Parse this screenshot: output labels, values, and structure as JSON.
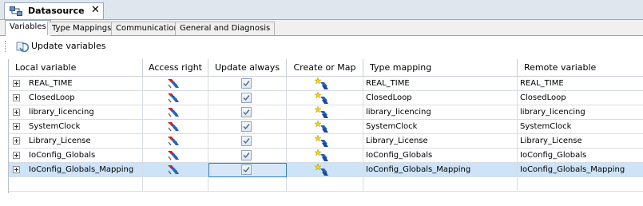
{
  "document_tab": {
    "title": "Datasource",
    "icon": "datasource-icon",
    "close_label": "✕"
  },
  "sub_tabs": [
    {
      "label": "Variables",
      "active": true
    },
    {
      "label": "Type Mappings",
      "active": false
    },
    {
      "label": "Communication",
      "active": false
    },
    {
      "label": "General and Diagnosis",
      "active": false
    }
  ],
  "toolbar": {
    "update_label": "Update variables"
  },
  "table": {
    "headers": {
      "local_variable": "Local variable",
      "access_right": "Access right",
      "update_always": "Update always",
      "create_or_map": "Create or Map",
      "type_mapping": "Type mapping",
      "remote_variable": "Remote variable"
    },
    "rows": [
      {
        "local": "REAL_TIME",
        "update_always": true,
        "type_mapping": "REAL_TIME",
        "remote": "REAL_TIME"
      },
      {
        "local": "ClosedLoop",
        "update_always": true,
        "type_mapping": "ClosedLoop",
        "remote": "ClosedLoop"
      },
      {
        "local": "library_licencing",
        "update_always": true,
        "type_mapping": "library_licencing",
        "remote": "library_licencing"
      },
      {
        "local": "SystemClock",
        "update_always": true,
        "type_mapping": "SystemClock",
        "remote": "SystemClock"
      },
      {
        "local": "Library_License",
        "update_always": true,
        "type_mapping": "Library_License",
        "remote": "Library_License"
      },
      {
        "local": "IoConfig_Globals",
        "update_always": true,
        "type_mapping": "IoConfig_Globals",
        "remote": "IoConfig_Globals"
      },
      {
        "local": "IoConfig_Globals_Mapping",
        "update_always": true,
        "type_mapping": "IoConfig_Globals_Mapping",
        "remote": "IoConfig_Globals_Mapping",
        "selected": true
      }
    ]
  },
  "colors": {
    "selection": "#cde3f7",
    "header_strip": "#dfe6ee",
    "accent": "#3c7fb1"
  }
}
